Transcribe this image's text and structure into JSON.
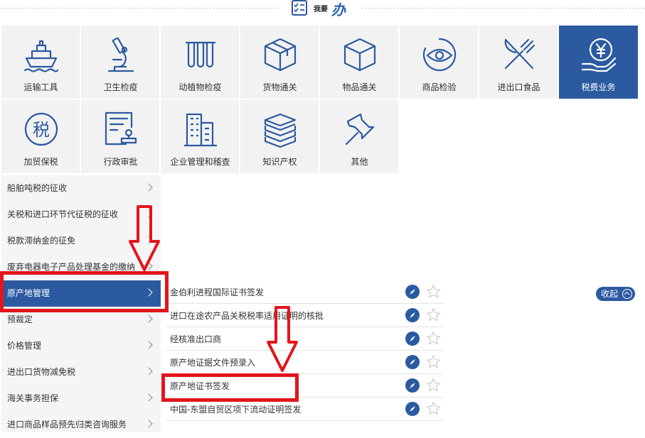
{
  "header": {
    "title_small": "我要",
    "title_big": "办"
  },
  "categories": [
    {
      "label": "运输工具",
      "icon": "ship-icon",
      "active": false
    },
    {
      "label": "卫生检疫",
      "icon": "microscope-icon",
      "active": false
    },
    {
      "label": "动植物检疫",
      "icon": "test-tubes-icon",
      "active": false
    },
    {
      "label": "货物通关",
      "icon": "package-icon",
      "active": false
    },
    {
      "label": "物品通关",
      "icon": "box-icon",
      "active": false
    },
    {
      "label": "商品检验",
      "icon": "eye-icon",
      "active": false
    },
    {
      "label": "进出口食品",
      "icon": "fork-knife-icon",
      "active": false
    },
    {
      "label": "税费业务",
      "icon": "yen-hand-icon",
      "active": true
    },
    {
      "label": "加贸保税",
      "icon": "tax-circle-icon",
      "active": false
    },
    {
      "label": "行政审批",
      "icon": "approval-stamp-icon",
      "active": false
    },
    {
      "label": "企业管理和稽查",
      "icon": "building-icon",
      "active": false
    },
    {
      "label": "知识产权",
      "icon": "books-icon",
      "active": false
    },
    {
      "label": "其他",
      "icon": "pushpin-icon",
      "active": false
    }
  ],
  "left_nav": [
    {
      "label": "船舶吨税的征收",
      "active": false
    },
    {
      "label": "关税和进口环节代征税的征收",
      "active": false
    },
    {
      "label": "税款滞纳金的征免",
      "active": false
    },
    {
      "label": "废弃电器电子产品处理基金的缴纳",
      "active": false
    },
    {
      "label": "原产地管理",
      "active": true
    },
    {
      "label": "预裁定",
      "active": false
    },
    {
      "label": "价格管理",
      "active": false
    },
    {
      "label": "进出口货物减免税",
      "active": false
    },
    {
      "label": "海关事务担保",
      "active": false
    },
    {
      "label": "进口商品样品预先归类咨询服务",
      "active": false
    }
  ],
  "sub_items": [
    {
      "label": "金伯利进程国际证书签发"
    },
    {
      "label": "进口在途农产品关税税率适用证明的核批"
    },
    {
      "label": "经核准出口商"
    },
    {
      "label": "原产地证据文件预录入"
    },
    {
      "label": "原产地证书签发"
    },
    {
      "label": "中国-东盟自贸区项下流动证明签发"
    }
  ],
  "collapse_label": "收起",
  "colors": {
    "accent": "#2b5aa0",
    "tile_bg": "#f2f2f2",
    "annotation": "#e3151c"
  }
}
